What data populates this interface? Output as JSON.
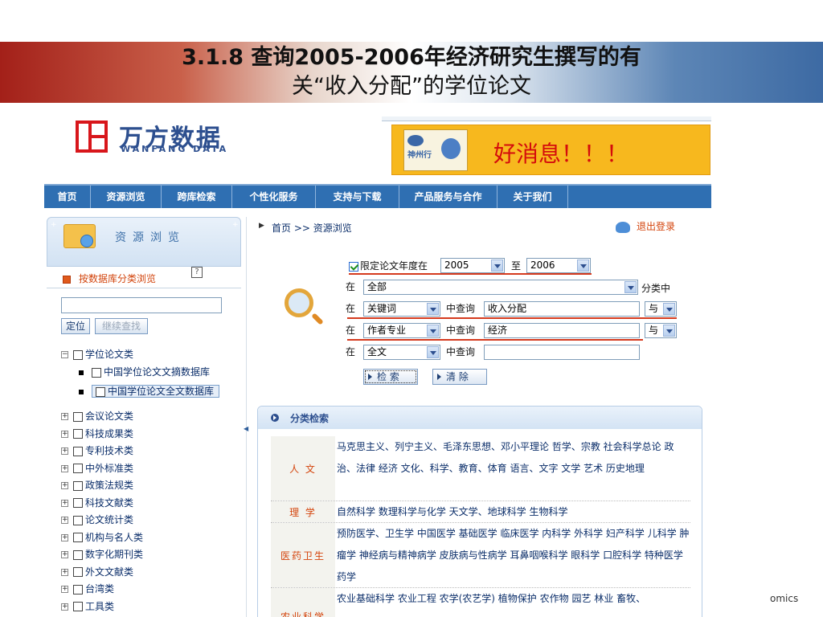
{
  "slide": {
    "title_line1": "3.1.8 查询2005-2006年经济研究生撰写的有",
    "title_line2": "关“收入分配”的学位论文",
    "footer": "omics"
  },
  "site": {
    "logo_cn": "万方数据",
    "logo_en": "WANFANG DATA",
    "ad_text": "好消息！！！",
    "ad_image_text": "神州行"
  },
  "nav": {
    "items": [
      "首页",
      "资源浏览",
      "跨库检索",
      "个性化服务",
      "支持与下载",
      "产品服务与合作",
      "关于我们"
    ]
  },
  "sidebar": {
    "title": "资源浏览",
    "by_category": "按数据库分类浏览",
    "help": "?",
    "locate_button": "定位",
    "continue_button": "继续查找",
    "tree": [
      {
        "label": "学位论文类",
        "expanded": true
      },
      {
        "label": "中国学位论文文摘数据库",
        "child": true
      },
      {
        "label": "中国学位论文全文数据库",
        "child": true,
        "selected": true
      },
      {
        "label": "会议论文类"
      },
      {
        "label": "科技成果类"
      },
      {
        "label": "专利技术类"
      },
      {
        "label": "中外标准类"
      },
      {
        "label": "政策法规类"
      },
      {
        "label": "科技文献类"
      },
      {
        "label": "论文统计类"
      },
      {
        "label": "机构与名人类"
      },
      {
        "label": "数字化期刊类"
      },
      {
        "label": "外文文献类"
      },
      {
        "label": "台湾类"
      },
      {
        "label": "工具类"
      }
    ]
  },
  "content": {
    "breadcrumb": "首页 >> 资源浏览",
    "logout": "退出登录",
    "search": {
      "limit_year_label": "限定论文年度在",
      "year_from": "2005",
      "to_label": "至",
      "year_to": "2006",
      "in_label": "在",
      "category_value": "全部",
      "category_suffix": "分类中",
      "field1": "关键词",
      "field2": "作者专业",
      "field3": "全文",
      "query_label": "中查询",
      "query1": "收入分配",
      "query2": "经济",
      "query3": "",
      "op1": "与",
      "op2": "与",
      "search_button": "检  索",
      "clear_button": "清  除"
    },
    "categories": {
      "title": "分类检索",
      "rows": [
        {
          "name": "人 文",
          "items": "马克思主义、列宁主义、毛泽东思想、邓小平理论 哲学、宗教 社会科学总论 政治、法律 经济 文化、科学、教育、体育 语言、文字 文学 艺术 历史地理"
        },
        {
          "name": "理 学",
          "items": "自然科学 数理科学与化学 天文学、地球科学 生物科学"
        },
        {
          "name": "医药卫生",
          "items": "预防医学、卫生学 中国医学 基础医学 临床医学 内科学 外科学 妇产科学 儿科学 肿瘤学 神经病与精神病学 皮肤病与性病学 耳鼻咽喉科学 眼科学 口腔科学 特种医学 药学"
        },
        {
          "name": "农业科学",
          "items": "农业基础科学 农业工程 农学(农艺学) 植物保护 农作物 园艺 林业 畜牧、"
        }
      ]
    }
  }
}
